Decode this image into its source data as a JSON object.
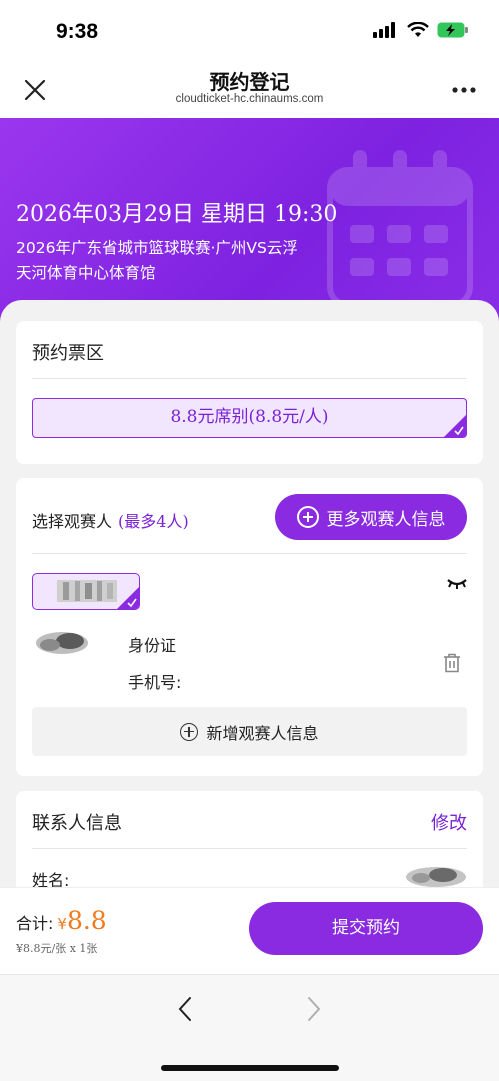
{
  "status_bar": {
    "time": "9:38",
    "icons": [
      "signal-icon",
      "wifi-icon",
      "battery-charging-icon"
    ]
  },
  "nav": {
    "title": "预约登记",
    "subtitle": "cloudticket-hc.chinaums.com",
    "close_icon": "close-icon",
    "more_icon": "more-icon"
  },
  "event": {
    "datetime": "2026年03月29日 星期日 19:30",
    "name": "2026年广东省城市篮球联赛·广州VS云浮",
    "venue": "天河体育中心体育馆"
  },
  "ticket_zone": {
    "title": "预约票区",
    "selected": "8.8元席别(8.8元/人)"
  },
  "viewers": {
    "title": "选择观赛人",
    "max_note": "(最多4人)",
    "more_button": "更多观赛人信息",
    "id_label": "身份证",
    "phone_label": "手机号:",
    "add_button": "新增观赛人信息"
  },
  "contact": {
    "title": "联系人信息",
    "edit": "修改",
    "name_label": "姓名:"
  },
  "footer": {
    "total_label": "合计:",
    "currency": "¥",
    "total_amount": "8.8",
    "price_detail": "¥8.8元/张 x 1张",
    "submit": "提交预约"
  },
  "colors": {
    "accent": "#8a2be2",
    "accent_text": "#7a22d6",
    "price": "#f07a1c",
    "chip_bg": "#f1e6fd"
  }
}
